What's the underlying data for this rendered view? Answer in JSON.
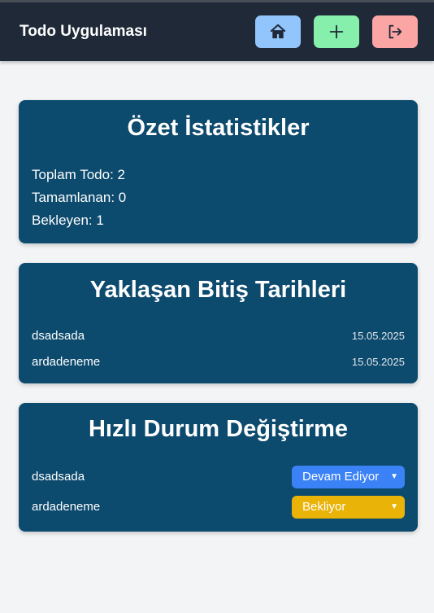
{
  "header": {
    "title": "Todo Uygulaması",
    "buttons": [
      {
        "name": "home",
        "icon": "home-icon",
        "color": "#93c5fd"
      },
      {
        "name": "add",
        "icon": "plus-icon",
        "color": "#86efac"
      },
      {
        "name": "logout",
        "icon": "logout-icon",
        "color": "#fca5a5"
      }
    ]
  },
  "summary": {
    "title": "Özet İstatistikler",
    "total": "Toplam Todo: 2",
    "completed": "Tamamlanan: 0",
    "pending": "Bekleyen: 1"
  },
  "deadlines": {
    "title": "Yaklaşan Bitiş Tarihleri",
    "items": [
      {
        "name": "dsadsada",
        "date": "15.05.2025"
      },
      {
        "name": "ardadeneme",
        "date": "15.05.2025"
      }
    ]
  },
  "quick_status": {
    "title": "Hızlı Durum Değiştirme",
    "items": [
      {
        "name": "dsadsada",
        "status": "Devam Ediyor",
        "color": "#3b82f6"
      },
      {
        "name": "ardadeneme",
        "status": "Bekliyor",
        "color": "#eab308"
      }
    ]
  },
  "colors": {
    "navbar": "#1f2937",
    "card": "#0c4a6e",
    "background": "#f3f4f6"
  }
}
